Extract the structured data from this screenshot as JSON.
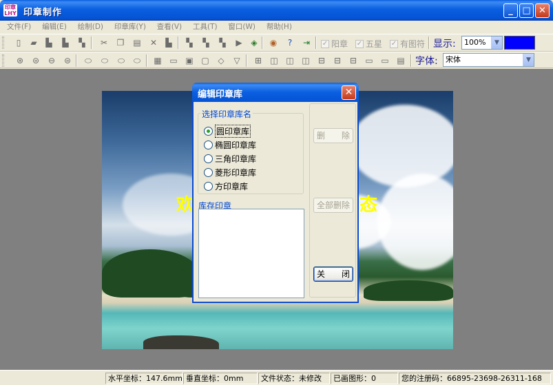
{
  "window": {
    "title": "印章制作",
    "icon_text_top": "印章",
    "icon_text_bottom": "LHY",
    "min": "_",
    "max": "□",
    "close": "✕"
  },
  "menu": [
    "文件(F)",
    "编辑(E)",
    "绘制(D)",
    "印章库(Y)",
    "查看(V)",
    "工具(T)",
    "窗口(W)",
    "帮助(H)"
  ],
  "toolbar": {
    "checkbox_yangzhang": "阳章",
    "checkbox_wuxing": "五星",
    "checkbox_youtufu": "有图符",
    "display_label": "显示:",
    "zoom_value": "100%",
    "color_value": "#0000ff",
    "font_label": "字体:",
    "font_value": "宋体"
  },
  "canvas": {
    "welcome_left": "欢",
    "welcome_right": "态"
  },
  "dialog": {
    "title": "编辑印章库",
    "close": "✕",
    "group_label": "选择印章库名",
    "options": [
      "圆印章库",
      "椭圆印章库",
      "三角印章库",
      "菱形印章库",
      "方印章库"
    ],
    "selected_index": 0,
    "list_label": "库存印章",
    "delete_button": "删　　除",
    "delete_all_button": "全部删除",
    "close_button": "关　　闭"
  },
  "status": {
    "x_coord": "水平坐标：147.6mm",
    "y_coord": "垂直坐标：0mm",
    "file_state": "文件状态：未修改",
    "drawn_shapes": "已画图形：0",
    "reg_code": "您的注册码：66895-23698-26311-168"
  }
}
